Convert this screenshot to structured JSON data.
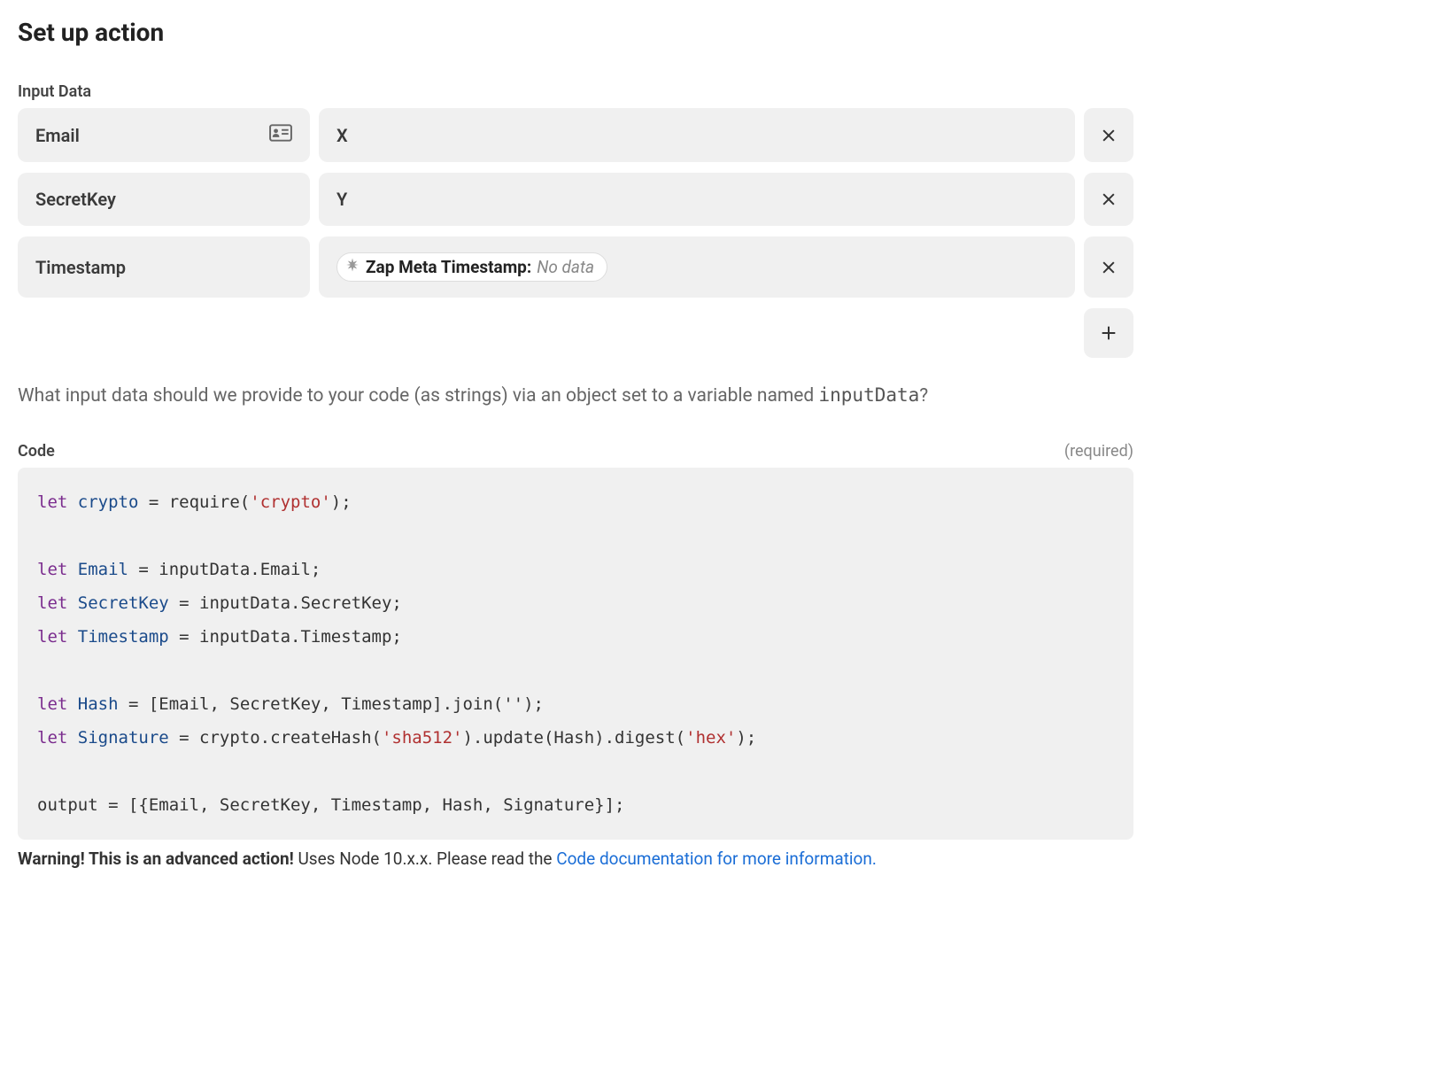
{
  "title": "Set up action",
  "input_data_label": "Input Data",
  "inputs": [
    {
      "label": "Email",
      "value": "X",
      "has_id_icon": true,
      "is_pill": false
    },
    {
      "label": "SecretKey",
      "value": "Y",
      "has_id_icon": false,
      "is_pill": false
    },
    {
      "label": "Timestamp",
      "value": "",
      "has_id_icon": false,
      "is_pill": true,
      "pill_label": "Zap Meta Timestamp:",
      "pill_nodata": "No data"
    }
  ],
  "helper_text_prefix": "What input data should we provide to your code (as strings) via an object set to a variable named ",
  "helper_text_code": "inputData",
  "helper_text_suffix": "?",
  "code_label": "Code",
  "required_label": "(required)",
  "code_lines": [
    {
      "type": "let-require",
      "var": "crypto",
      "arg": "'crypto'"
    },
    {
      "type": "blank"
    },
    {
      "type": "let-assign",
      "var": "Email",
      "rhs": "inputData.Email;"
    },
    {
      "type": "let-assign",
      "var": "SecretKey",
      "rhs": "inputData.SecretKey;"
    },
    {
      "type": "let-assign",
      "var": "Timestamp",
      "rhs": "inputData.Timestamp;"
    },
    {
      "type": "blank"
    },
    {
      "type": "let-assign",
      "var": "Hash",
      "rhs": "[Email, SecretKey, Timestamp].join('');"
    },
    {
      "type": "let-hash",
      "var": "Signature",
      "prefix": "crypto.createHash(",
      "arg1": "'sha512'",
      "mid": ").update(Hash).digest(",
      "arg2": "'hex'",
      "suffix": ");"
    },
    {
      "type": "blank"
    },
    {
      "type": "plain",
      "text": "output = [{Email, SecretKey, Timestamp, Hash, Signature}];"
    }
  ],
  "warning_bold": "Warning! This is an advanced action!",
  "warning_text": " Uses Node 10.x.x. Please read the ",
  "warning_link": "Code documentation for more information."
}
